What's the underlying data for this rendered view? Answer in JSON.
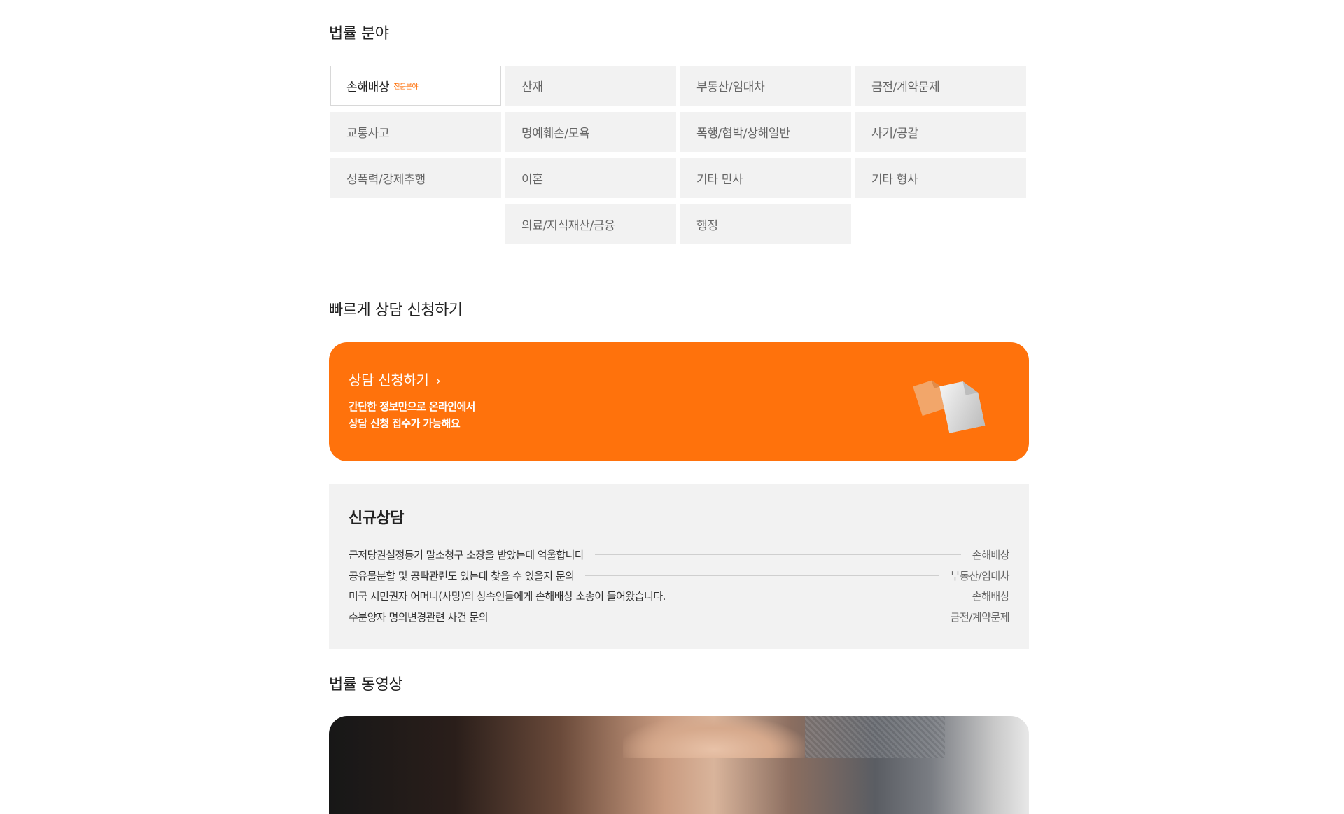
{
  "law_section": {
    "title": "법률 분야",
    "categories": [
      {
        "label": "손해배상",
        "tag": "전문분야"
      },
      {
        "label": "산재"
      },
      {
        "label": "부동산/임대차"
      },
      {
        "label": "금전/계약문제"
      },
      {
        "label": "교통사고"
      },
      {
        "label": "명예훼손/모욕"
      },
      {
        "label": "폭행/협박/상해일반"
      },
      {
        "label": "사기/공갈"
      },
      {
        "label": "성폭력/강제추행"
      },
      {
        "label": "이혼"
      },
      {
        "label": "기타 민사"
      },
      {
        "label": "기타 형사"
      },
      {
        "label": "의료/지식재산/금융"
      },
      {
        "label": "행정"
      }
    ]
  },
  "quick_section": {
    "title": "빠르게 상담 신청하기",
    "banner_title": "상담 신청하기",
    "banner_chevron": "›",
    "banner_desc_line1": "간단한 정보만으로 온라인에서",
    "banner_desc_line2": "상담 신청 접수가 가능해요",
    "banner_icon": "documents-icon",
    "accent_color": "#ff720c"
  },
  "consult_section": {
    "title": "신규상담",
    "items": [
      {
        "question": "근저당권설정등기 말소청구 소장을 받았는데 억울합니다",
        "category": "손해배상"
      },
      {
        "question": "공유물분할 및 공탁관련도 있는데 찾을 수 있을지 문의",
        "category": "부동산/임대차"
      },
      {
        "question": "미국 시민권자 어머니(사망)의 상속인들에게 손해배상 소송이 들어왔습니다.",
        "category": "손해배상"
      },
      {
        "question": "수분양자 명의변경관련 사건 문의",
        "category": "금전/계약문제"
      }
    ]
  },
  "video_section": {
    "title": "법률 동영상"
  }
}
